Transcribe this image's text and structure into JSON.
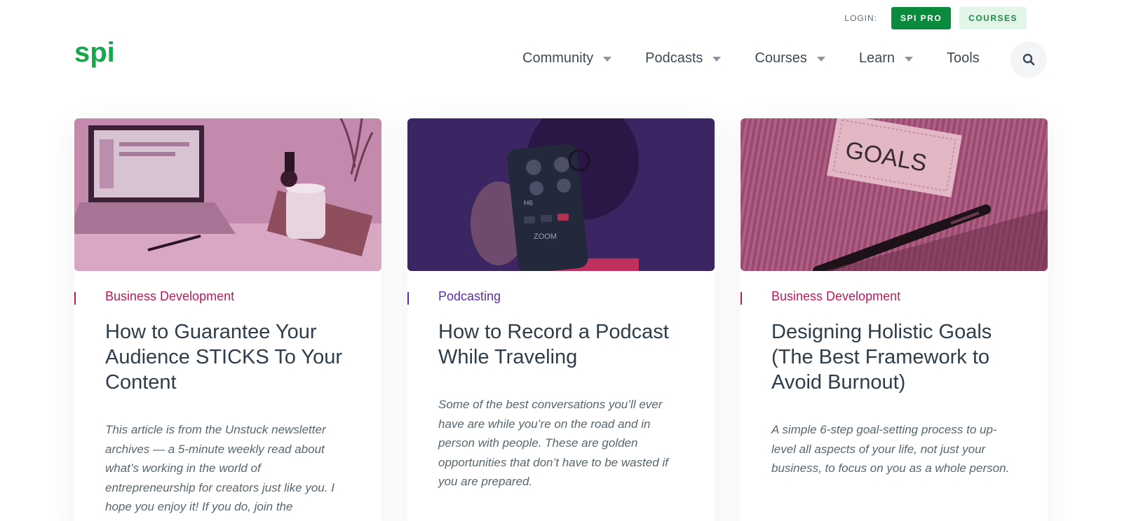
{
  "header": {
    "login_label": "LOGIN:",
    "pro_label": "SPI PRO",
    "courses_label": "COURSES",
    "logo_text": "spi"
  },
  "nav": {
    "items": [
      {
        "label": "Community",
        "has_dropdown": true
      },
      {
        "label": "Podcasts",
        "has_dropdown": true
      },
      {
        "label": "Courses",
        "has_dropdown": true
      },
      {
        "label": "Learn",
        "has_dropdown": true
      },
      {
        "label": "Tools",
        "has_dropdown": false
      }
    ],
    "search_icon": "search-icon"
  },
  "colors": {
    "brand_green": "#0a8a3c",
    "category_business": "#c2185b",
    "category_podcasting": "#5b2bb5"
  },
  "cards": [
    {
      "category": "Business Development",
      "title": "How to Guarantee Your Audience STICKS To Your Content",
      "excerpt": "This article is from the Unstuck newsletter archives — a 5-minute weekly read about what’s working in the world of entrepreneurship for creators just like you. I hope you enjoy it! If you do, join the"
    },
    {
      "category": "Podcasting",
      "title": "How to Record a Podcast While Traveling",
      "excerpt": "Some of the best conversations you’ll ever have are while you’re on the road and in person with people. These are golden opportunities that don’t have to be wasted if you are prepared."
    },
    {
      "category": "Business Development",
      "title": "Designing Holistic Goals (The Best Framework to Avoid Burnout)",
      "excerpt": "A simple 6-step goal-setting process to up-level all aspects of your life, not just your business, to focus on you as a whole person."
    }
  ],
  "image_labels": {
    "recorder_model": "H6",
    "recorder_brand": "ZOOM",
    "goals_tag": "GOALS"
  }
}
